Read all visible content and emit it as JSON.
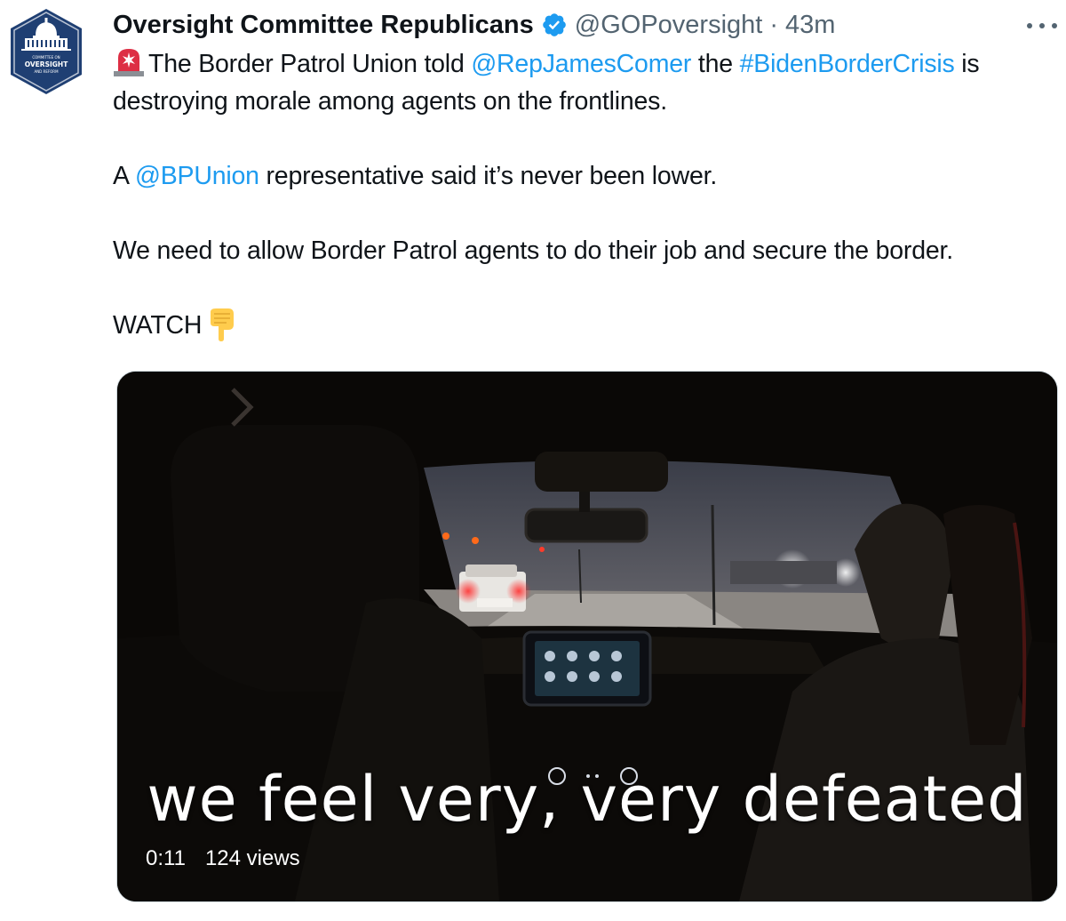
{
  "tweet": {
    "author": {
      "display_name": "Oversight Committee Republicans",
      "handle": "@GOPoversight",
      "time": "43m",
      "avatar_icon": "capitol-seal-icon",
      "avatar_text_top": "COMMITTEE ON",
      "avatar_text_main": "OVERSIGHT",
      "avatar_text_bottom": "AND REFORM",
      "verified_icon": "verified-badge-icon",
      "verified_color": "#1d9bf0"
    },
    "separator": "·",
    "body": {
      "line1_a": "The Border Patrol Union told ",
      "mention1": "@RepJamesComer",
      "line1_b": " the ",
      "hashtag1": "#BidenBorderCrisis",
      "line1_c": " is destroying morale among agents on the frontlines.",
      "para2_a": "A ",
      "mention2": "@BPUnion",
      "para2_b": " representative said it’s never been lower.",
      "para3": "We need to allow Border Patrol agents to do their job and secure the border.",
      "para4": "WATCH",
      "emoji_siren": "rotating-light-icon",
      "emoji_point": "pointing-down-icon"
    },
    "media": {
      "caption": "we feel very, very defeated",
      "timestamp": "0:11",
      "views": "124 views"
    },
    "colors": {
      "link": "#1d9bf0",
      "secondary_text": "#536471",
      "primary_text": "#0f1419"
    }
  }
}
